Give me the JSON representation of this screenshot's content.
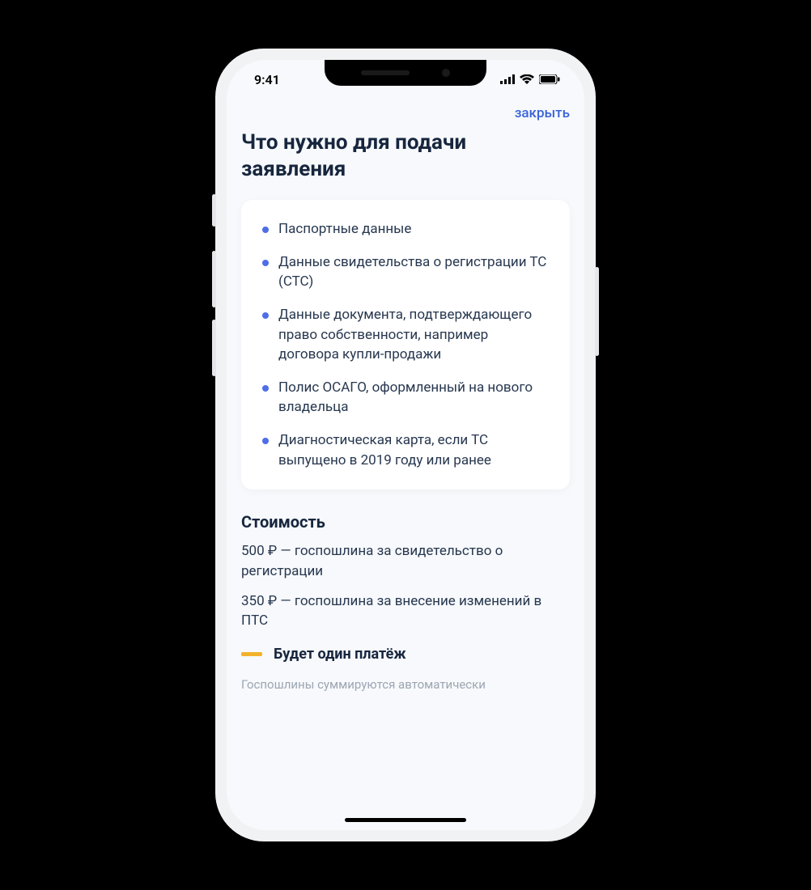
{
  "status": {
    "time": "9:41"
  },
  "nav": {
    "close_label": "закрыть"
  },
  "main": {
    "title": "Что нужно для подачи заявления",
    "requirements": [
      "Паспортные данные",
      "Данные свидетельства о регистрации ТС (СТС)",
      "Данные документа, подтверждающего право собственности, например договора купли-продажи",
      "Полис ОСАГО, оформленный на нового владельца",
      "Диагностическая карта, если ТС выпущено в 2019 году или ранее"
    ],
    "cost_heading": "Стоимость",
    "costs": [
      "500 ₽ — госпошлина за свидетельство о регистрации",
      "350 ₽ — госпошлина за внесение изменений в ПТС"
    ],
    "single_payment_label": "Будет один платёж",
    "hint": "Госпошлины суммируются автоматически"
  },
  "colors": {
    "accent_blue": "#4e6ee8",
    "link_blue": "#3b63d8",
    "accent_yellow": "#f3b22b",
    "text_primary": "#17263e",
    "text_secondary": "#27374f",
    "text_muted": "#9da6b2",
    "bg": "#f7f9fc",
    "card_bg": "#ffffff"
  }
}
